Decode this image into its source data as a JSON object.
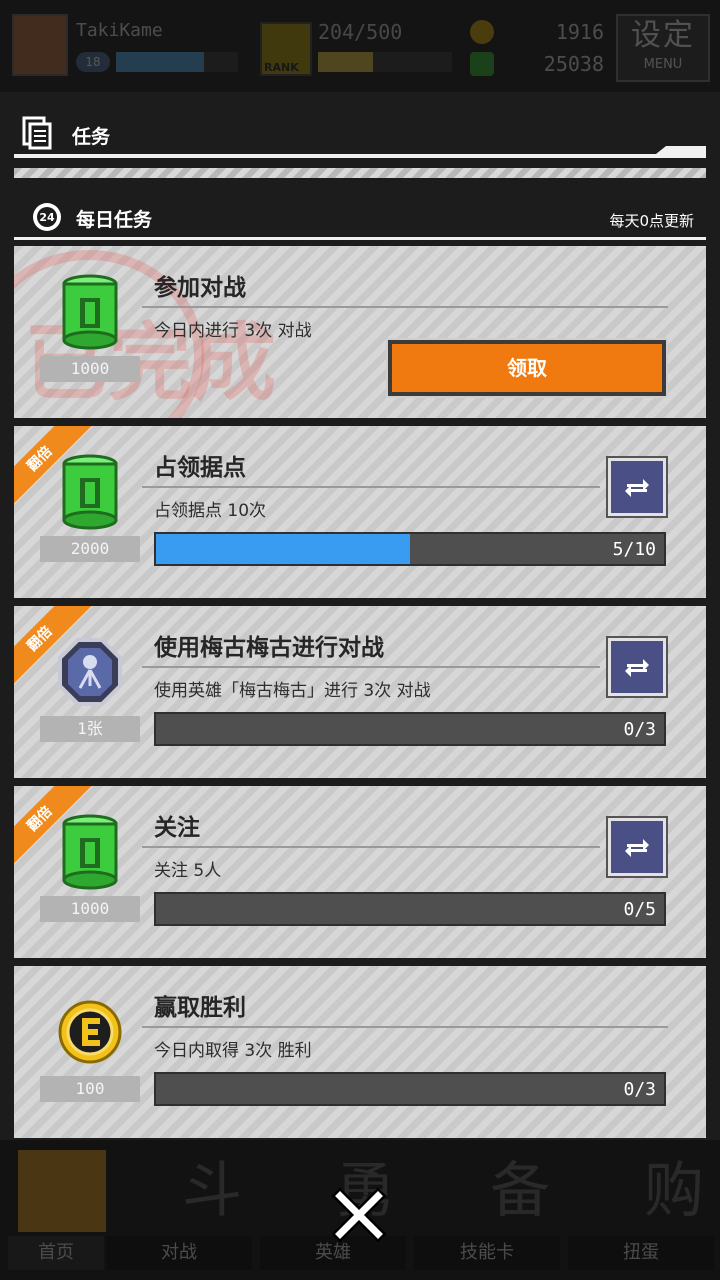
{
  "topbar": {
    "username": "TakiKame",
    "level": "18",
    "exp_fraction": 0.72,
    "rank_label": "RANK",
    "stamina": "204/500",
    "stamina_fraction": 0.41,
    "gold": "1916",
    "gems": "25038",
    "settings_label": "设定",
    "settings_sub": "MENU"
  },
  "panel": {
    "title": "任务"
  },
  "section": {
    "title": "每日任务",
    "note": "每天0点更新"
  },
  "tasks": [
    {
      "title": "参加对战",
      "desc": "今日内进行 3次 对战",
      "reward_icon": "green-barrel-icon",
      "reward": "1000",
      "claim_label": "领取",
      "stamp": "已完成",
      "complete": true
    },
    {
      "title": "占领据点",
      "desc": "占领据点 10次",
      "reward_icon": "green-barrel-icon",
      "reward": "2000",
      "progress": "5/10",
      "fraction": 0.5,
      "ribbon": "翻倍"
    },
    {
      "title": "使用梅古梅古进行对战",
      "desc": "使用英雄「梅古梅古」进行 3次 对战",
      "reward_icon": "hero-badge-icon",
      "reward": "1张",
      "progress": "0/3",
      "fraction": 0,
      "ribbon": "翻倍"
    },
    {
      "title": "关注",
      "desc": "关注 5人",
      "reward_icon": "green-barrel-icon",
      "reward": "1000",
      "progress": "0/5",
      "fraction": 0,
      "ribbon": "翻倍"
    },
    {
      "title": "赢取胜利",
      "desc": "今日内取得 3次 胜利",
      "reward_icon": "gold-coin-icon",
      "reward": "100",
      "progress": "0/3",
      "fraction": 0
    }
  ],
  "nav": {
    "home": "首页",
    "battle": "对战",
    "heroes": "英雄",
    "skills": "技能卡",
    "gacha": "扭蛋",
    "battle_big": "斗",
    "heroes_big": "勇",
    "skills_big": "备",
    "gacha_big": "购"
  },
  "colors": {
    "accent_orange": "#f07a10",
    "progress_blue": "#3a9cf0",
    "refresh_button": "#4a4f86",
    "ribbon": "#f08a1c"
  }
}
